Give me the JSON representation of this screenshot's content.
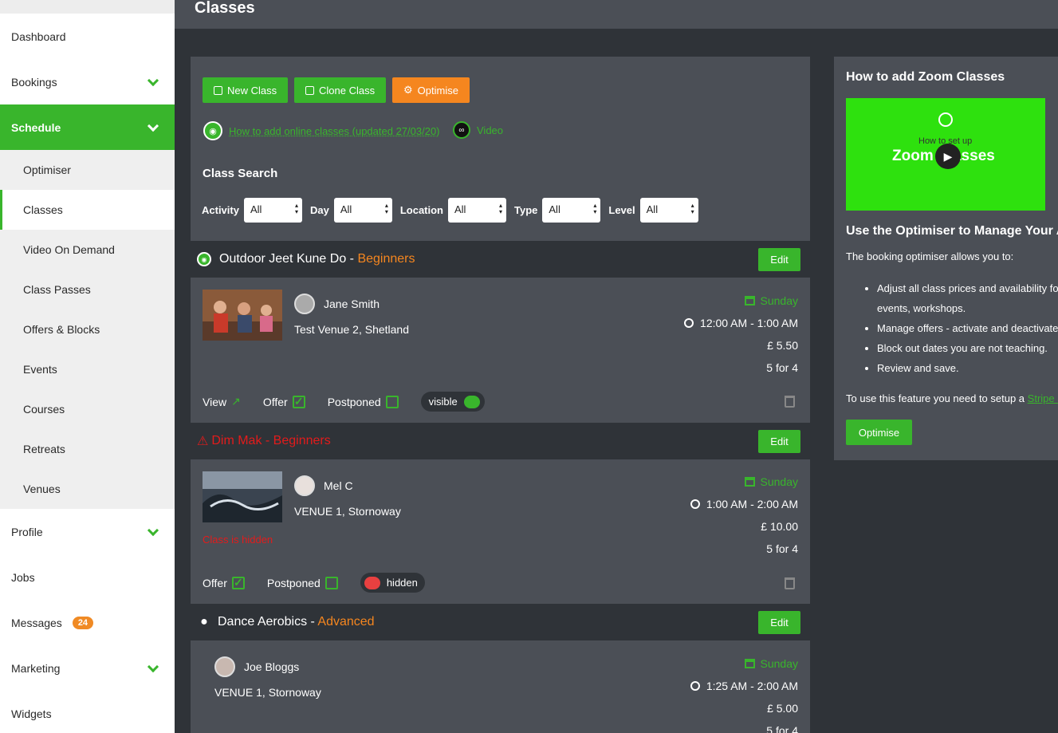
{
  "page": {
    "title": "Classes"
  },
  "sidebar": {
    "items": [
      {
        "label": "Dashboard"
      },
      {
        "label": "Bookings"
      },
      {
        "label": "Schedule"
      },
      {
        "label": "Profile"
      },
      {
        "label": "Jobs"
      },
      {
        "label": "Messages",
        "badge": "24"
      },
      {
        "label": "Marketing"
      },
      {
        "label": "Widgets"
      }
    ],
    "schedule_sub": [
      {
        "label": "Optimiser"
      },
      {
        "label": "Classes"
      },
      {
        "label": "Video On Demand"
      },
      {
        "label": "Class Passes"
      },
      {
        "label": "Offers & Blocks"
      },
      {
        "label": "Events"
      },
      {
        "label": "Courses"
      },
      {
        "label": "Retreats"
      },
      {
        "label": "Venues"
      }
    ]
  },
  "toolbar": {
    "new_class": "New Class",
    "clone_class": "Clone Class",
    "optimise": "Optimise",
    "help_link": "How to add online classes (updated 27/03/20)",
    "video_link": "Video"
  },
  "search": {
    "title": "Class Search",
    "filters": [
      {
        "label": "Activity",
        "value": "All"
      },
      {
        "label": "Day",
        "value": "All"
      },
      {
        "label": "Location",
        "value": "All"
      },
      {
        "label": "Type",
        "value": "All"
      },
      {
        "label": "Level",
        "value": "All"
      }
    ]
  },
  "classes": [
    {
      "name": "Outdoor Jeet Kune Do",
      "separator": " - ",
      "level": "Beginners",
      "edit": "Edit",
      "teacher": "Jane Smith",
      "venue": "Test Venue 2, Shetland",
      "day": "Sunday",
      "time": "12:00 AM - 1:00 AM",
      "price": "£  5.50",
      "offer": "5 for 4",
      "view": "View",
      "offer_label": "Offer",
      "postponed": "Postponed",
      "visibility": "visible"
    },
    {
      "name": "Dim Mak",
      "separator": " - ",
      "level": "Beginners",
      "edit": "Edit",
      "teacher": "Mel C",
      "venue": "VENUE 1, Stornoway",
      "hidden_note": "Class is hidden",
      "day": "Sunday",
      "time": "1:00 AM - 2:00 AM",
      "price": "£  10.00",
      "offer": "5 for 4",
      "offer_label": "Offer",
      "postponed": "Postponed",
      "visibility": "hidden"
    },
    {
      "name": "Dance Aerobics",
      "separator": " - ",
      "level": "Advanced",
      "edit": "Edit",
      "teacher": "Joe Bloggs",
      "venue": "VENUE 1, Stornoway",
      "day": "Sunday",
      "time": "1:25 AM - 2:00 AM",
      "price": "£  5.00",
      "offer": "5 for 4"
    }
  ],
  "right_panel": {
    "title": "How to add Zoom Classes",
    "video_sub": "How to set up",
    "video_big": "Zoom Classes",
    "heading": "Use the Optimiser to Manage Your A",
    "intro": "The booking optimiser allows you to:",
    "bullets": [
      "Adjust all class prices and availability fo",
      "events, workshops.",
      "Manage offers - activate and deactivate",
      "Block out dates you are not teaching.",
      "Review and save."
    ],
    "setup_text": "To use this feature you need to setup a ",
    "setup_link": "Stripe a",
    "button": "Optimise"
  },
  "colors": {
    "accent": "#39b52c",
    "orange": "#f5861f",
    "alert": "#e31b1b",
    "panel": "#4b4f56",
    "dark": "#2f3338"
  },
  "icons": [
    "plus-square-icon",
    "copy-icon",
    "gear-icon",
    "broadcast-icon",
    "video-icon",
    "calendar-icon",
    "clock-icon",
    "external-link-icon",
    "check-icon",
    "trash-icon",
    "warning-icon",
    "map-pin-icon",
    "chevron-down-icon",
    "play-icon"
  ]
}
